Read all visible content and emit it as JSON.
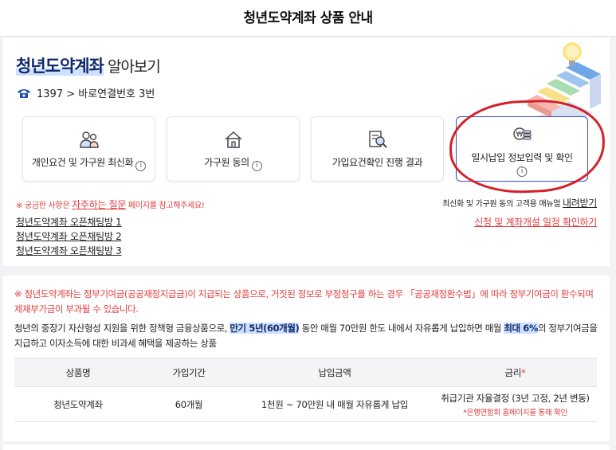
{
  "header": {
    "title": "청년도약계좌 상품 안내"
  },
  "intro": {
    "title_strong": "청년도약계좌",
    "title_rest": " 알아보기",
    "phone_text": "1397 > 바로연결번호 3번"
  },
  "cards": [
    {
      "label": "개인요건 및 가구원 최신화",
      "icon": "people-icon"
    },
    {
      "label": "가구원 동의",
      "icon": "house-icon"
    },
    {
      "label": "가입요건확인 진행 결과",
      "icon": "document-search-icon"
    },
    {
      "label": "일시납입 정보입력 및 확인",
      "icon": "money-coins-icon"
    }
  ],
  "info_glyph": "i",
  "notes": {
    "faq_prefix": "※ 궁금한 사항은 ",
    "faq_link": "자주하는 질문",
    "faq_suffix": " 페이지를 참고해주세요!",
    "manual_prefix": "최신화 및 가구원 동의 고객용 매뉴얼 ",
    "manual_link": "내려받기",
    "schedule_link": "신청 및 계좌개설 일정 확인하기"
  },
  "chat_links": [
    "청년도약계좌 오픈채팅방 1",
    "청년도약계좌 오픈채팅방 2",
    "청년도약계좌 오픈채팅방 3"
  ],
  "warning": "※ 청년도약계좌는 정부기여금(공공재정지급금)이 지급되는 상품으로, 거짓된 정보로 부정청구를 하는 경우 「공공재정환수법」에 따라 정부기여금이 환수되며 제재부가금이 부과될 수 있습니다.",
  "description": {
    "part1": "청년의 중장기 자산형성 지원을 위한 정책형 금융상품으로, ",
    "hl1": "만기 5년(60개월)",
    "part2": " 동안 매월 70만원 한도 내에서 자유롭게 납입하면 매월 ",
    "hl2": "최대 6%",
    "part3": "의 정부기여금을 지급하고 이자소득에 대한 비과세 혜택을 제공하는 상품"
  },
  "table": {
    "headers": [
      "상품명",
      "가입기간",
      "납입금액",
      "금리"
    ],
    "required_mark": "*",
    "row": {
      "name": "청년도약계좌",
      "period": "60개월",
      "amount": "1천원 ~ 70만원 내 매월 자유롭게 납입",
      "rate": "취급기관 자율결정 (3년 고정, 2년 변동)",
      "rate_note": "*은행연합회 홈페이지를 통해 확인"
    }
  },
  "colors": {
    "accent": "#0f2a6e",
    "warning": "#e23c3c",
    "annotation": "#d4202a",
    "highlight": "#cfe0ff"
  }
}
